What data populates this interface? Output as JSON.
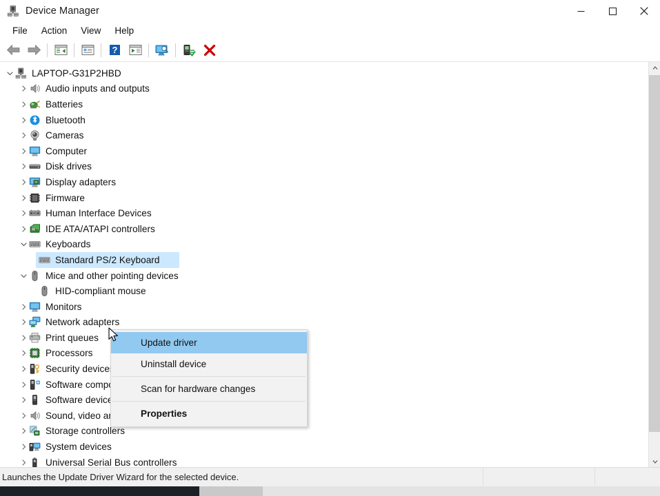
{
  "window": {
    "title": "Device Manager",
    "icon": "device-manager-icon",
    "caption": {
      "minimize": "minimize-icon",
      "maximize": "maximize-icon",
      "close": "close-icon"
    }
  },
  "menubar": {
    "items": [
      {
        "label": "File"
      },
      {
        "label": "Action"
      },
      {
        "label": "View"
      },
      {
        "label": "Help"
      }
    ]
  },
  "toolbar": {
    "buttons": [
      {
        "name": "back-arrow-icon",
        "title": "Back"
      },
      {
        "name": "forward-arrow-icon",
        "title": "Forward"
      },
      {
        "name": "show-hide-console-tree-icon",
        "title": "Show/Hide Console Tree"
      },
      {
        "name": "properties-icon",
        "title": "Properties"
      },
      {
        "name": "help-icon",
        "title": "Help"
      },
      {
        "name": "update-driver-icon",
        "title": "Update driver"
      },
      {
        "name": "scan-hardware-changes-icon",
        "title": "Scan for hardware changes"
      },
      {
        "name": "enable-device-icon",
        "title": "Enable device"
      },
      {
        "name": "uninstall-device-icon",
        "title": "Uninstall device"
      }
    ]
  },
  "tree": {
    "root": {
      "label": "LAPTOP-G31P2HBD",
      "icon": "computer-root-icon",
      "expanded": true
    },
    "items": [
      {
        "label": "Audio inputs and outputs",
        "icon": "speaker-icon",
        "depth": 1,
        "expandable": true,
        "expanded": false,
        "selected": false
      },
      {
        "label": "Batteries",
        "icon": "battery-icon",
        "depth": 1,
        "expandable": true,
        "expanded": false,
        "selected": false
      },
      {
        "label": "Bluetooth",
        "icon": "bluetooth-icon",
        "depth": 1,
        "expandable": true,
        "expanded": false,
        "selected": false
      },
      {
        "label": "Cameras",
        "icon": "camera-icon",
        "depth": 1,
        "expandable": true,
        "expanded": false,
        "selected": false
      },
      {
        "label": "Computer",
        "icon": "monitor-icon",
        "depth": 1,
        "expandable": true,
        "expanded": false,
        "selected": false
      },
      {
        "label": "Disk drives",
        "icon": "disk-drive-icon",
        "depth": 1,
        "expandable": true,
        "expanded": false,
        "selected": false
      },
      {
        "label": "Display adapters",
        "icon": "display-adapter-icon",
        "depth": 1,
        "expandable": true,
        "expanded": false,
        "selected": false
      },
      {
        "label": "Firmware",
        "icon": "firmware-chip-icon",
        "depth": 1,
        "expandable": true,
        "expanded": false,
        "selected": false
      },
      {
        "label": "Human Interface Devices",
        "icon": "hid-icon",
        "depth": 1,
        "expandable": true,
        "expanded": false,
        "selected": false
      },
      {
        "label": "IDE ATA/ATAPI controllers",
        "icon": "ide-controller-icon",
        "depth": 1,
        "expandable": true,
        "expanded": false,
        "selected": false
      },
      {
        "label": "Keyboards",
        "icon": "keyboard-icon",
        "depth": 1,
        "expandable": true,
        "expanded": true,
        "selected": false
      },
      {
        "label": "Standard PS/2 Keyboard",
        "icon": "keyboard-icon",
        "depth": 2,
        "expandable": false,
        "expanded": false,
        "selected": true
      },
      {
        "label": "Mice and other pointing devices",
        "icon": "mouse-icon",
        "depth": 1,
        "expandable": true,
        "expanded": true,
        "selected": false
      },
      {
        "label": "HID-compliant mouse",
        "icon": "mouse-icon",
        "depth": 2,
        "expandable": false,
        "expanded": false,
        "selected": false
      },
      {
        "label": "Monitors",
        "icon": "monitor-icon",
        "depth": 1,
        "expandable": true,
        "expanded": false,
        "selected": false
      },
      {
        "label": "Network adapters",
        "icon": "network-adapter-icon",
        "depth": 1,
        "expandable": true,
        "expanded": false,
        "selected": false
      },
      {
        "label": "Print queues",
        "icon": "printer-icon",
        "depth": 1,
        "expandable": true,
        "expanded": false,
        "selected": false
      },
      {
        "label": "Processors",
        "icon": "processor-icon",
        "depth": 1,
        "expandable": true,
        "expanded": false,
        "selected": false
      },
      {
        "label": "Security devices",
        "icon": "security-device-icon",
        "depth": 1,
        "expandable": true,
        "expanded": false,
        "selected": false
      },
      {
        "label": "Software components",
        "icon": "software-component-icon",
        "depth": 1,
        "expandable": true,
        "expanded": false,
        "selected": false
      },
      {
        "label": "Software devices",
        "icon": "software-device-icon",
        "depth": 1,
        "expandable": true,
        "expanded": false,
        "selected": false
      },
      {
        "label": "Sound, video and game controllers",
        "icon": "speaker-icon",
        "depth": 1,
        "expandable": true,
        "expanded": false,
        "selected": false
      },
      {
        "label": "Storage controllers",
        "icon": "storage-controller-icon",
        "depth": 1,
        "expandable": true,
        "expanded": false,
        "selected": false
      },
      {
        "label": "System devices",
        "icon": "system-device-icon",
        "depth": 1,
        "expandable": true,
        "expanded": false,
        "selected": false
      },
      {
        "label": "Universal Serial Bus controllers",
        "icon": "usb-controller-icon",
        "depth": 1,
        "expandable": true,
        "expanded": false,
        "selected": false
      }
    ]
  },
  "context_menu": {
    "items": [
      {
        "label": "Update driver",
        "highlighted": true,
        "bold": false,
        "separator_after": false
      },
      {
        "label": "Uninstall device",
        "highlighted": false,
        "bold": false,
        "separator_after": true
      },
      {
        "label": "Scan for hardware changes",
        "highlighted": false,
        "bold": false,
        "separator_after": true
      },
      {
        "label": "Properties",
        "highlighted": false,
        "bold": true,
        "separator_after": false
      }
    ]
  },
  "statusbar": {
    "message": "Launches the Update Driver Wizard for the selected device."
  },
  "colors": {
    "selection": "#cce8ff",
    "menu_highlight": "#91c9f0",
    "window_bg": "#ffffff",
    "status_bg": "#f0f0f0",
    "menu_bg": "#f2f2f2"
  }
}
